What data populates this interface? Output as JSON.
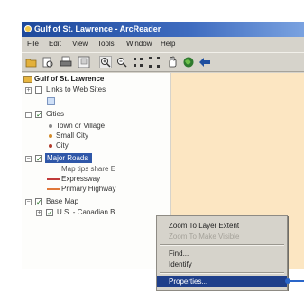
{
  "window": {
    "title": "Gulf of St. Lawrence - ArcReader"
  },
  "menu": [
    "File",
    "Edit",
    "View",
    "Tools",
    "Window",
    "Help"
  ],
  "toolbar_icons": [
    "open-folder-icon",
    "print-preview-icon",
    "print-icon",
    "layout-icon",
    "zoom-in-icon",
    "zoom-out-icon",
    "fixed-zoom-in-icon",
    "fixed-zoom-out-icon",
    "pan-icon",
    "globe-full-extent-icon",
    "back-arrow-icon"
  ],
  "toc": {
    "root": "Gulf of St. Lawrence",
    "items": [
      {
        "label": "Links to Web Sites",
        "checked": false
      },
      {
        "label": "Cities",
        "checked": true
      },
      {
        "label": "Town or Village"
      },
      {
        "label": "Small City"
      },
      {
        "label": "City"
      },
      {
        "label": "Major Roads",
        "checked": true,
        "selected": true
      },
      {
        "label": "Map tips share E"
      },
      {
        "label": "Expressway"
      },
      {
        "label": "Primary Highway"
      },
      {
        "label": "Base Map",
        "checked": true
      },
      {
        "label": "U.S. - Canadian B",
        "checked": true
      }
    ]
  },
  "context_menu": {
    "items": [
      {
        "label": "Zoom To Layer Extent",
        "enabled": true
      },
      {
        "label": "Zoom To Make Visible",
        "enabled": false
      },
      {
        "label": "Find...",
        "enabled": true
      },
      {
        "label": "Identify",
        "enabled": true
      },
      {
        "label": "Properties...",
        "enabled": true,
        "selected": true
      }
    ]
  },
  "colors": {
    "title_bar": "#1f4a9c",
    "map_background": "#fce6c2",
    "selection": "#2f57a8",
    "town_symbol": "#8a8a8a",
    "small_city_symbol": "#d28a2a",
    "city_symbol": "#b23a2a",
    "expressway_symbol": "#c03a3a",
    "primary_highway_symbol": "#e0783a"
  }
}
